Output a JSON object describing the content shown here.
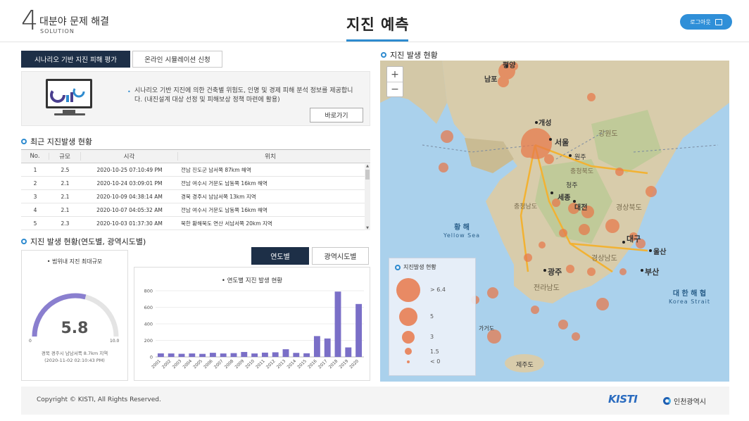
{
  "header": {
    "logo_number": "4",
    "logo_title": "대분야 문제 해결",
    "logo_subtitle": "SOLUTION",
    "page_title": "지진 예측",
    "logout_label": "로그아웃"
  },
  "tabs": {
    "active": "시나리오 기반 지진 피해 평가",
    "inactive": "온라인 시뮬레이션 신청"
  },
  "banner": {
    "description": "시나리오 기반 지진에 의한 건축별 위험도, 인명 및 경제 피해 분석 정보를 제공합니다. (내진설계 대상 선정 및 피해보상 정책 마련에 활용)",
    "button_label": "바로가기",
    "bullet": "•"
  },
  "recent": {
    "title": "최근 지진발생 현황",
    "columns": {
      "no": "No.",
      "magnitude": "규모",
      "time": "시각",
      "location": "위치"
    },
    "rows": [
      {
        "no": "1",
        "magnitude": "2.5",
        "time": "2020-10-25 07:10:49 PM",
        "location": "전남 진도군 남서쪽 87km 해역"
      },
      {
        "no": "2",
        "magnitude": "2.1",
        "time": "2020-10-24 03:09:01 PM",
        "location": "전남 여수시 거문도 남동쪽 16km 해역"
      },
      {
        "no": "3",
        "magnitude": "2.1",
        "time": "2020-10-09 04:38:14 AM",
        "location": "경북 경주시 남남서쪽 13km 지역"
      },
      {
        "no": "4",
        "magnitude": "2.1",
        "time": "2020-10-07 04:05:32 AM",
        "location": "전남 여수시 거문도 남동쪽 16km 해역"
      },
      {
        "no": "5",
        "magnitude": "2.3",
        "time": "2020-10-03 01:37:30 AM",
        "location": "북한 황해북도 연산 서남서쪽 20km 지역"
      }
    ]
  },
  "stats": {
    "title": "지진 발생 현황(연도별, 광역시도별)",
    "seg_year": "연도별",
    "seg_region": "광역시도별",
    "gauge": {
      "title": "범위내 지진 최대규모",
      "value": "5.8",
      "value_num": 5.8,
      "min": "0",
      "max": "10.0",
      "max_num": 10,
      "desc_line1": "경북 경주시 남남서쪽 8.7km 지역",
      "desc_line2": "(2020-11-02 02:10:43 PM)",
      "color": "#8a7fcf"
    }
  },
  "chart_data": {
    "type": "bar",
    "title": "연도별 지진 발생 현황",
    "categories": [
      "2001",
      "2002",
      "2003",
      "2004",
      "2005",
      "2006",
      "2007",
      "2008",
      "2009",
      "2010",
      "2011",
      "2012",
      "2013",
      "2014",
      "2015",
      "2016",
      "2017",
      "2018",
      "2019",
      "2020"
    ],
    "values": [
      43,
      42,
      38,
      42,
      37,
      50,
      42,
      46,
      60,
      42,
      52,
      56,
      93,
      49,
      44,
      252,
      223,
      790,
      115,
      640
    ],
    "ylim": [
      0,
      800
    ],
    "yticks": [
      0,
      200,
      400,
      600,
      800
    ],
    "color": "#7a6fc7"
  },
  "map": {
    "title": "지진 발생 현황",
    "zoom_in": "+",
    "zoom_out": "−",
    "seas": [
      {
        "ko": "황 해",
        "en": "Yellow Sea"
      },
      {
        "ko": "대 한 해 협",
        "en": "Korea Strait"
      }
    ],
    "cities": [
      "평양",
      "남포",
      "개성",
      "서울",
      "원주",
      "강원도",
      "청주",
      "세종",
      "대전",
      "충청남도",
      "충청북도",
      "경상북도",
      "대구",
      "울산",
      "광주",
      "부산",
      "전라남도",
      "경상남도",
      "제주도",
      "가거도"
    ],
    "legend": {
      "title": "지진발생 현황",
      "items": [
        "> 6.4",
        "5",
        "3",
        "1.5",
        "< 0"
      ]
    },
    "marker_color": "#e8784a"
  },
  "footer": {
    "copyright": "Copyright © KISTI, All Rights Reserved.",
    "kisti": "KISTI",
    "incheon": "인천광역시"
  }
}
